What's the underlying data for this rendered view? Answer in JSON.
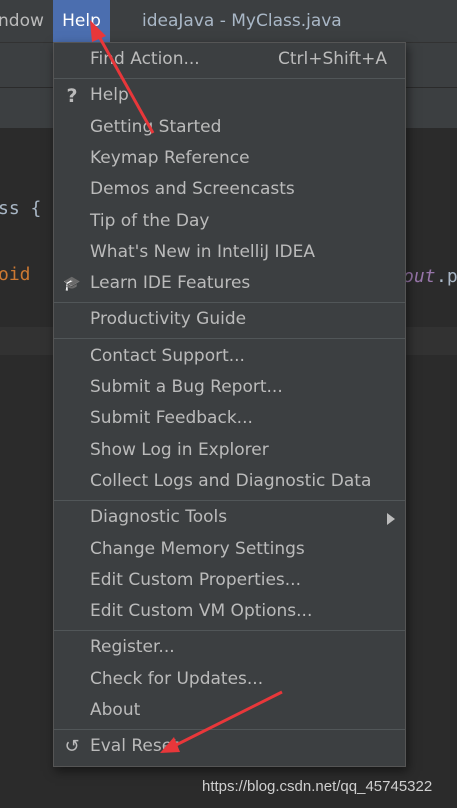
{
  "menubar": {
    "window_fragment": "ndow",
    "help_label": "Help",
    "title": "ideaJava - MyClass.java"
  },
  "editor": {
    "line1": "ss {",
    "line2": "oid",
    "line2_right_italic": "out",
    "line2_right_tail": ".p"
  },
  "help_menu": {
    "groups": [
      [
        {
          "label": "Find Action...",
          "shortcut": "Ctrl+Shift+A"
        }
      ],
      [
        {
          "label": "Help",
          "icon": "question-icon"
        },
        {
          "label": "Getting Started"
        },
        {
          "label": "Keymap Reference"
        },
        {
          "label": "Demos and Screencasts"
        },
        {
          "label": "Tip of the Day"
        },
        {
          "label": "What's New in IntelliJ IDEA"
        },
        {
          "label": "Learn IDE Features",
          "icon": "graduation-cap-icon"
        }
      ],
      [
        {
          "label": "Productivity Guide"
        }
      ],
      [
        {
          "label": "Contact Support..."
        },
        {
          "label": "Submit a Bug Report..."
        },
        {
          "label": "Submit Feedback..."
        },
        {
          "label": "Show Log in Explorer"
        },
        {
          "label": "Collect Logs and Diagnostic Data"
        }
      ],
      [
        {
          "label": "Diagnostic Tools",
          "submenu": true
        },
        {
          "label": "Change Memory Settings"
        },
        {
          "label": "Edit Custom Properties..."
        },
        {
          "label": "Edit Custom VM Options..."
        }
      ],
      [
        {
          "label": "Register..."
        },
        {
          "label": "Check for Updates..."
        },
        {
          "label": "About"
        }
      ],
      [
        {
          "label": "Eval Reset",
          "icon": "reset-icon"
        }
      ]
    ]
  },
  "watermark": "https://blog.csdn.net/qq_45745322",
  "colors": {
    "menu_bg": "#3c3f41",
    "highlight": "#4b6eaf",
    "annotation_arrow": "#e8373a"
  }
}
